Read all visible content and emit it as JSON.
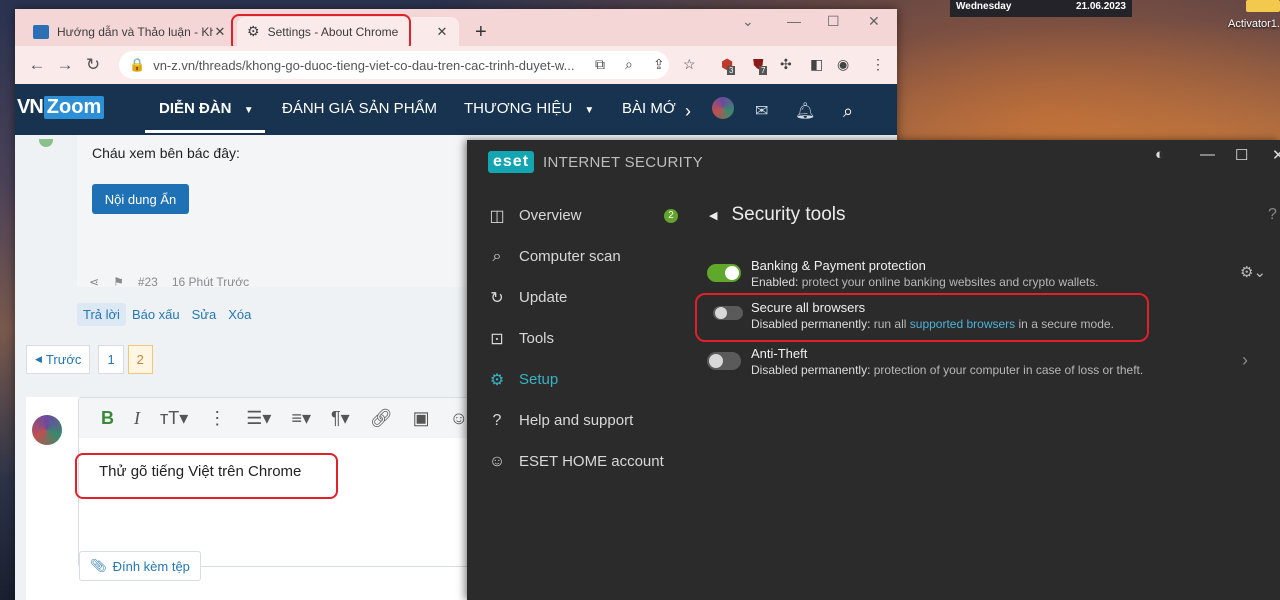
{
  "desktop": {
    "day": "Wednesday",
    "date": "21.06.2023",
    "activator_label": "Activator1."
  },
  "browser": {
    "tabs": [
      {
        "title": "Hướng dẫn và Thảo luận - Không"
      },
      {
        "title": "Settings - About Chrome"
      }
    ],
    "url": "vn-z.vn/threads/khong-go-duoc-tieng-viet-co-dau-tren-cac-trinh-duyet-w...",
    "ext_badges": [
      "3",
      "7"
    ]
  },
  "site": {
    "logo_vn": "VN",
    "logo_zoom": "Zoom",
    "nav": [
      "DIỄN ĐÀN",
      "ĐÁNH GIÁ SẢN PHẨM",
      "THƯƠNG HIỆU",
      "BÀI MỚ"
    ],
    "post_text": "Cháu xem bên bác đây:",
    "hidden_button": "Nội dung Ẩn",
    "post_number": "#23",
    "post_time": "16 Phút Trước",
    "actions": [
      "Trả lời",
      "Báo xấu",
      "Sửa",
      "Xóa"
    ],
    "pager": {
      "prev": "Trước",
      "pages": [
        "1",
        "2"
      ]
    },
    "editor_text": "Thử gõ tiếng Việt trên Chrome",
    "attach_label": "Đính kèm tệp"
  },
  "eset": {
    "logo": "eset",
    "product": "INTERNET SECURITY",
    "menu": [
      {
        "label": "Overview",
        "icon": "overview-icon",
        "badge": "2"
      },
      {
        "label": "Computer scan",
        "icon": "search-icon"
      },
      {
        "label": "Update",
        "icon": "refresh-icon"
      },
      {
        "label": "Tools",
        "icon": "briefcase-icon"
      },
      {
        "label": "Setup",
        "icon": "gear-icon",
        "active": true
      },
      {
        "label": "Help and support",
        "icon": "help-icon"
      },
      {
        "label": "ESET HOME account",
        "icon": "account-icon"
      }
    ],
    "title": "Security tools",
    "tools": [
      {
        "name": "Banking & Payment protection",
        "status": "Enabled:",
        "desc": "protect your online banking websites and crypto wallets.",
        "on": true
      },
      {
        "name": "Secure all browsers",
        "status": "Disabled permanently:",
        "desc_pre": "run all",
        "link": "supported browsers",
        "desc_post": "in a secure mode.",
        "on": false
      },
      {
        "name": "Anti-Theft",
        "status": "Disabled permanently:",
        "desc": "protection of your computer in case of loss or theft.",
        "on": false
      }
    ]
  }
}
